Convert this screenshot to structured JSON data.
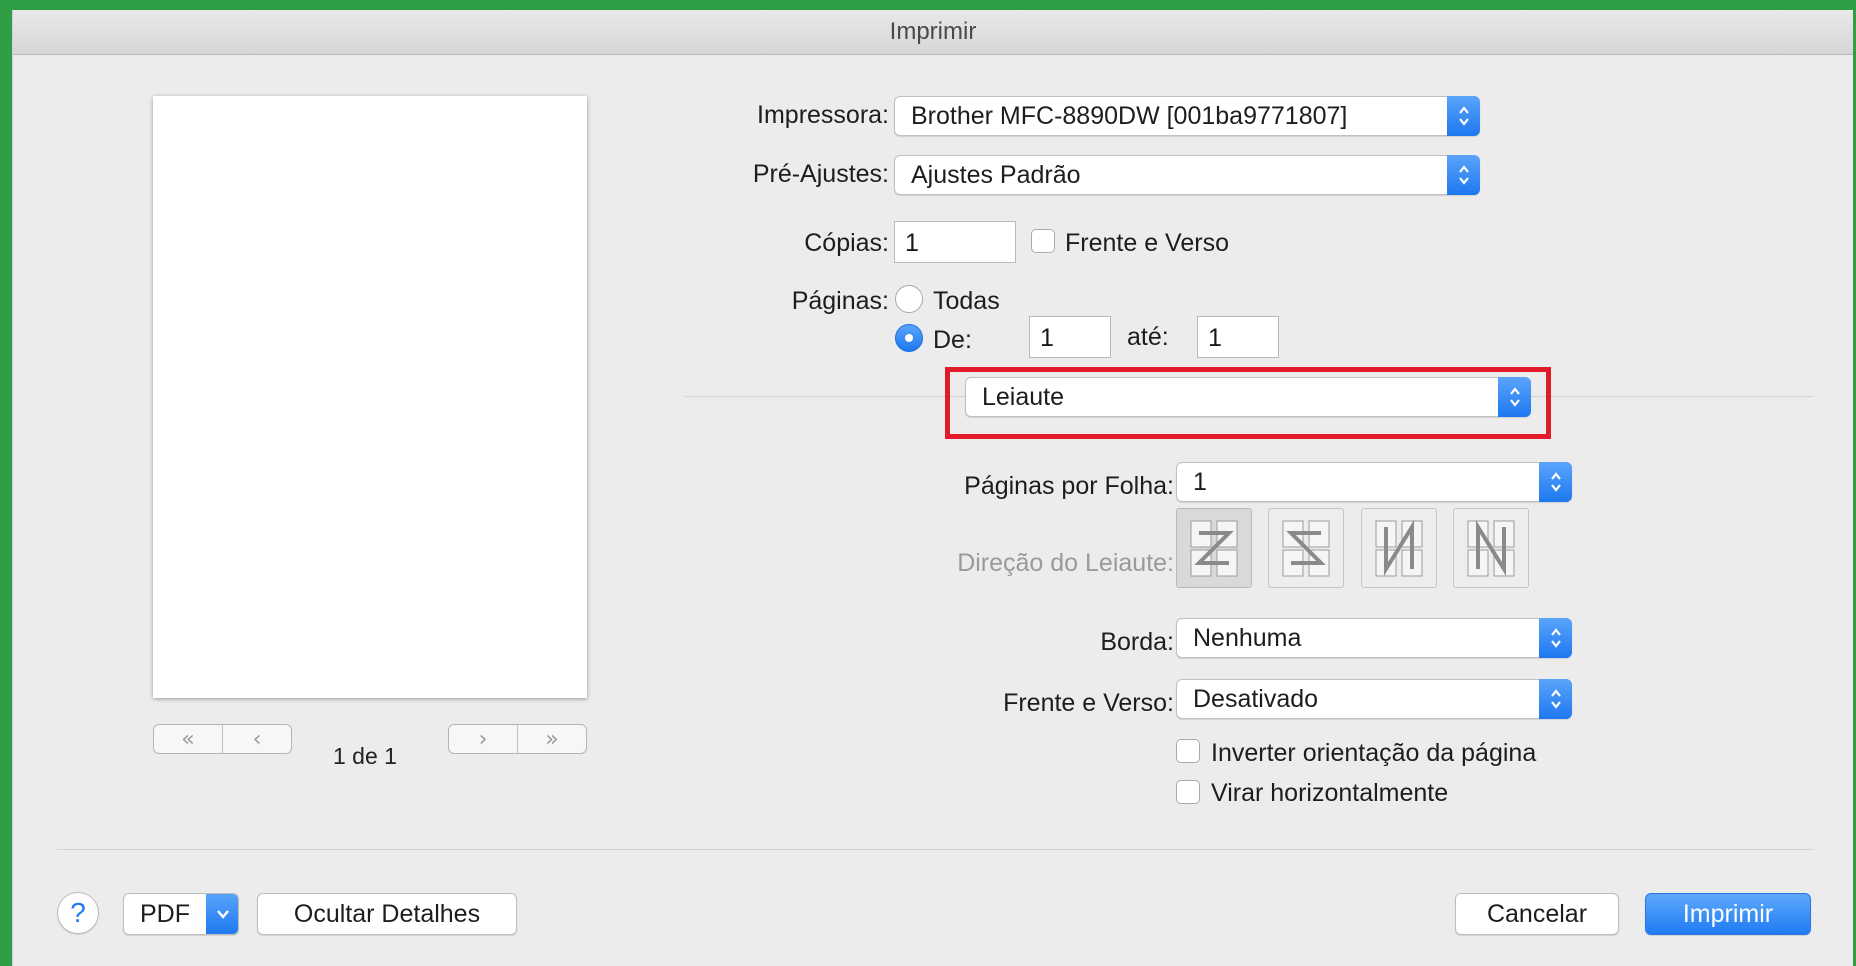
{
  "window": {
    "title": "Imprimir"
  },
  "preview": {
    "page_count": "1 de 1"
  },
  "printer": {
    "label": "Impressora:",
    "value": "Brother MFC-8890DW [001ba9771807]"
  },
  "presets": {
    "label": "Pré-Ajustes:",
    "value": "Ajustes Padrão"
  },
  "copies": {
    "label": "Cópias:",
    "value": "1",
    "duplex_label": "Frente e Verso"
  },
  "pages": {
    "label": "Páginas:",
    "all_label": "Todas",
    "from_label": "De:",
    "from_value": "1",
    "to_label": "até:",
    "to_value": "1"
  },
  "section_select": {
    "value": "Leiaute"
  },
  "layout": {
    "pages_per_sheet_label": "Páginas por Folha:",
    "pages_per_sheet_value": "1",
    "direction_label": "Direção do Leiaute:",
    "border_label": "Borda:",
    "border_value": "Nenhuma",
    "two_sided_label": "Frente e Verso:",
    "two_sided_value": "Desativado",
    "reverse_orientation_label": "Inverter orientação da página",
    "flip_horizontal_label": "Virar horizontalmente"
  },
  "footer": {
    "help_label": "?",
    "pdf_label": "PDF",
    "hide_details_label": "Ocultar Detalhes",
    "cancel_label": "Cancelar",
    "print_label": "Imprimir"
  },
  "colors": {
    "accent": "#1f7bf2",
    "highlight": "#e21b2a",
    "frame": "#2f9e45"
  }
}
